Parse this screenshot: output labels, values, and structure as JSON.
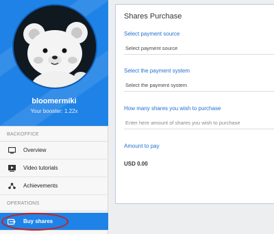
{
  "profile": {
    "username": "bloomermiki",
    "booster": "Your booster: 1.22x"
  },
  "sidebar": {
    "backoffice_heading": "BACKOFFICE",
    "operations_heading": "OPERATIONS",
    "items": [
      {
        "label": "Overview",
        "icon": "monitor-icon"
      },
      {
        "label": "Video tutorials",
        "icon": "video-icon"
      },
      {
        "label": "Achievements",
        "icon": "achievements-icon"
      }
    ],
    "operations_items": [
      {
        "label": "Buy shares",
        "icon": "shares-icon",
        "active": true
      }
    ]
  },
  "panel": {
    "title": "Shares Purchase",
    "payment_source_label": "Select payment source",
    "payment_source_value": "Select payment source",
    "payment_system_label": "Select the payment system",
    "payment_system_value": "Select the payment system",
    "shares_label": "How many shares you wish to purchase",
    "shares_placeholder": "Enter here amount of shares you wish to purchase",
    "amount_label": "Amount to pay",
    "amount_value": "USD 0.00"
  },
  "colors": {
    "accent": "#1f82e6",
    "label_blue": "#1f6fd1",
    "highlight": "#d11a1a"
  }
}
